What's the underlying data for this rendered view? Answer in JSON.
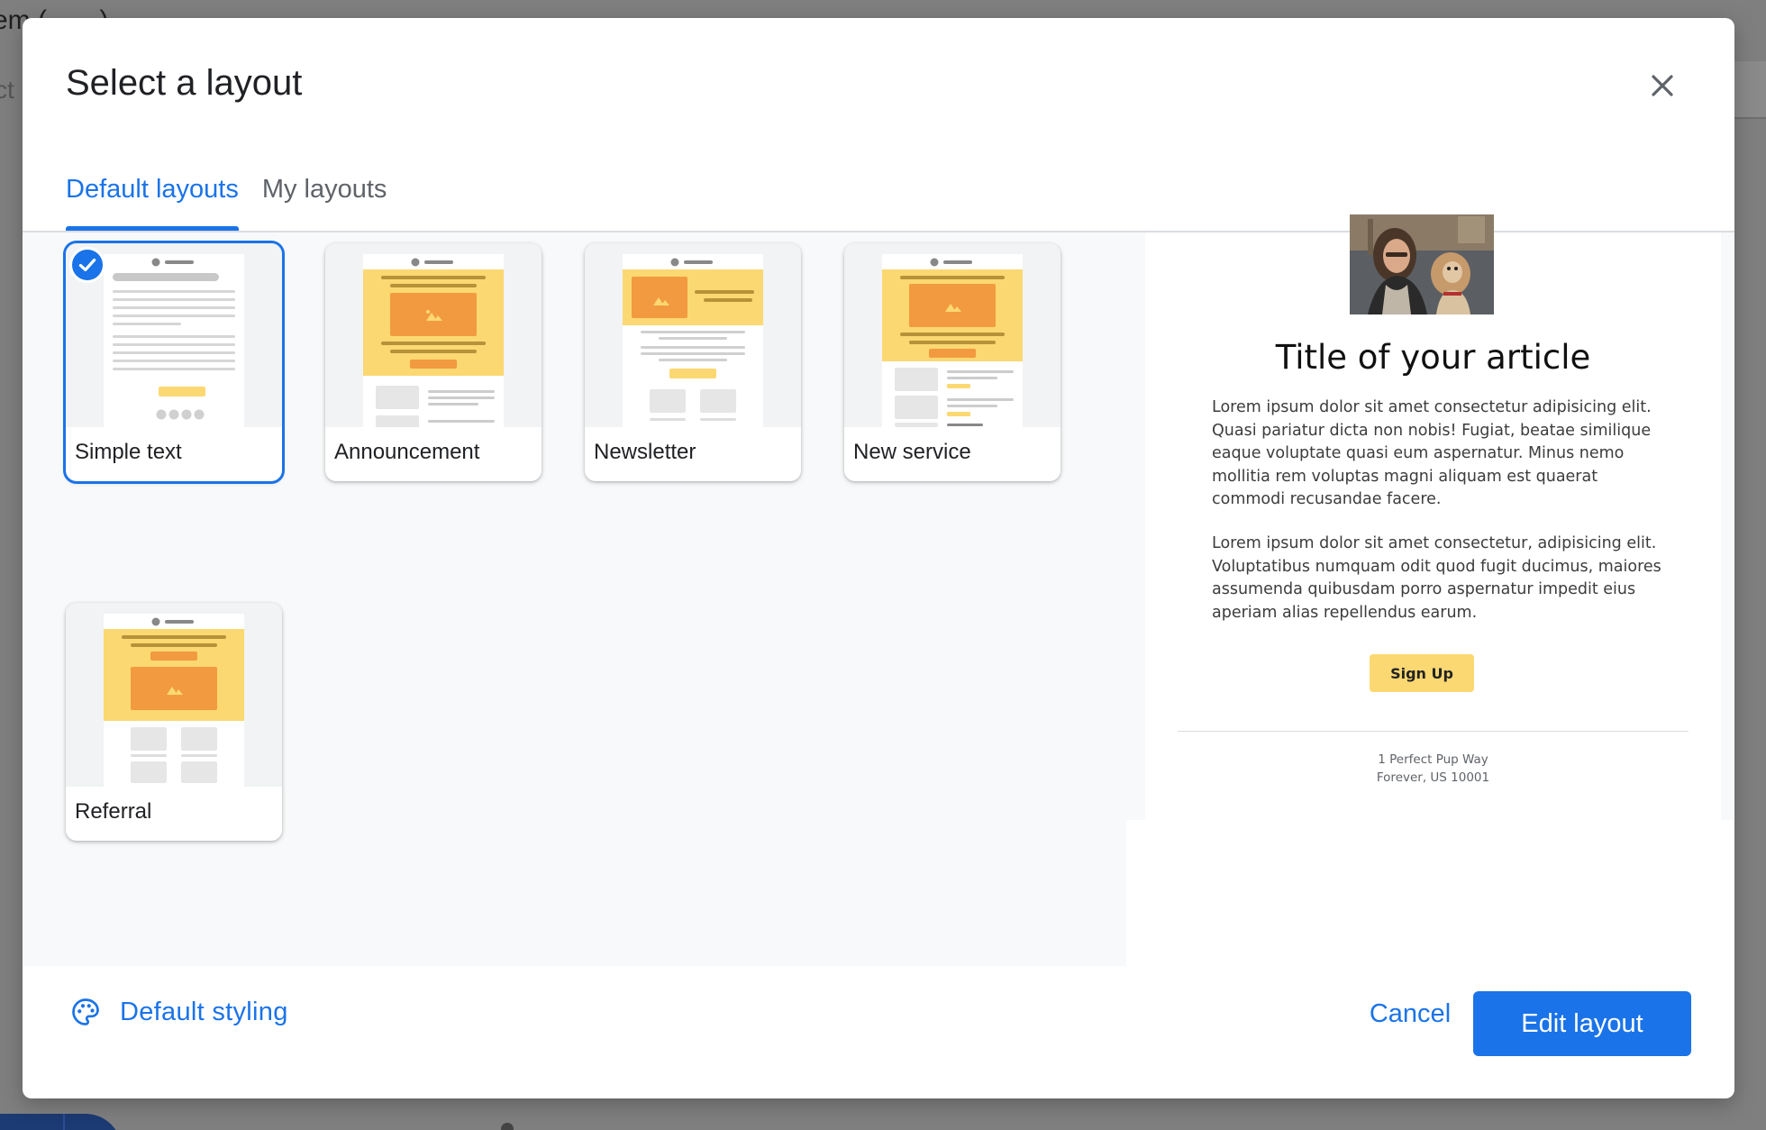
{
  "dialog": {
    "title": "Select a layout",
    "close_icon": "close-icon"
  },
  "tabs": [
    {
      "label": "Default layouts",
      "active": true
    },
    {
      "label": "My layouts",
      "active": false
    }
  ],
  "layouts": [
    {
      "label": "Simple text",
      "selected": true
    },
    {
      "label": "Announcement",
      "selected": false
    },
    {
      "label": "Newsletter",
      "selected": false
    },
    {
      "label": "New service",
      "selected": false
    },
    {
      "label": "Referral",
      "selected": false
    }
  ],
  "preview": {
    "title": "Title of your article",
    "paragraph1": "Lorem ipsum dolor sit amet consectetur adipisicing elit. Quasi pariatur dicta non nobis! Fugiat, beatae similique eaque voluptate quasi eum aspernatur. Minus nemo mollitia rem voluptas magni aliquam est quaerat commodi recusandae facere.",
    "paragraph2": "Lorem ipsum dolor sit amet consectetur, adipisicing elit. Voluptatibus numquam odit quod fugit ducimus, maiores assumenda quibusdam porro aspernatur impedit eius aperiam alias repellendus earum.",
    "button": "Sign Up",
    "address_line1": "1 Perfect Pup Way",
    "address_line2": "Forever, US 10001"
  },
  "footer": {
    "styling_label": "Default styling",
    "styling_icon": "palette-icon",
    "cancel_label": "Cancel",
    "edit_label": "Edit layout"
  },
  "colors": {
    "accent": "#1a73e8",
    "thumb_yellow": "#fbd872",
    "thumb_orange": "#f29a3f"
  }
}
